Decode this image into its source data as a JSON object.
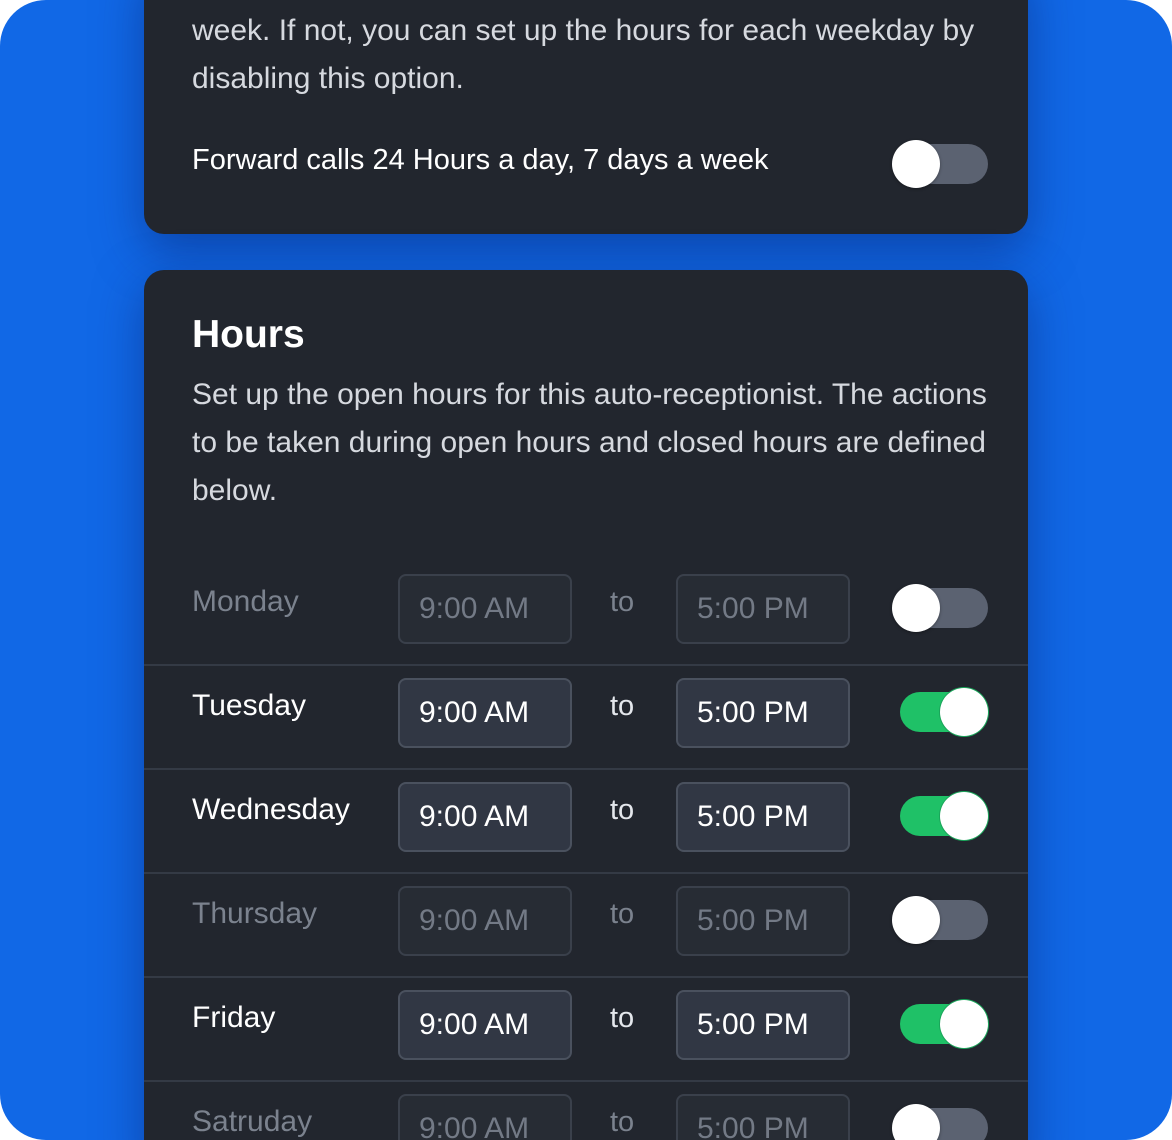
{
  "forwarding": {
    "description": "week. If not, you can set up the hours for each weekday by disabling this option.",
    "toggle_label": "Forward calls 24 Hours a day, 7 days a week",
    "enabled": false
  },
  "hours": {
    "title": "Hours",
    "description": "Set up the open hours for this auto-receptionist. The actions to be taken during open hours and closed hours are defined below.",
    "separator": "to",
    "days": [
      {
        "name": "Monday",
        "from": "9:00 AM",
        "until": "5:00 PM",
        "enabled": false
      },
      {
        "name": "Tuesday",
        "from": "9:00 AM",
        "until": "5:00 PM",
        "enabled": true
      },
      {
        "name": "Wednesday",
        "from": "9:00 AM",
        "until": "5:00 PM",
        "enabled": true
      },
      {
        "name": "Thursday",
        "from": "9:00 AM",
        "until": "5:00 PM",
        "enabled": false
      },
      {
        "name": "Friday",
        "from": "9:00 AM",
        "until": "5:00 PM",
        "enabled": true
      },
      {
        "name": "Satruday",
        "from": "9:00 AM",
        "until": "5:00 PM",
        "enabled": false
      }
    ]
  },
  "colors": {
    "background": "#1168e6",
    "card": "#22262e",
    "toggle_on": "#1fc167",
    "toggle_off": "#5b6271"
  }
}
